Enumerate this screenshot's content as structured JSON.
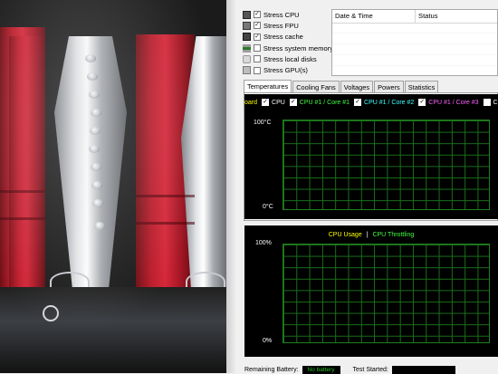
{
  "stress_options": [
    {
      "label": "Stress CPU",
      "checked": true,
      "icon": "cpu-icon"
    },
    {
      "label": "Stress FPU",
      "checked": true,
      "icon": "fpu-icon"
    },
    {
      "label": "Stress cache",
      "checked": true,
      "icon": "cache-icon"
    },
    {
      "label": "Stress system memory",
      "checked": false,
      "icon": "memory-icon"
    },
    {
      "label": "Stress local disks",
      "checked": false,
      "icon": "disk-icon"
    },
    {
      "label": "Stress GPU(s)",
      "checked": false,
      "icon": "gpu-icon"
    }
  ],
  "log": {
    "columns": [
      "Date & Time",
      "Status"
    ]
  },
  "tabs": [
    {
      "label": "Temperatures",
      "active": true
    },
    {
      "label": "Cooling Fans",
      "active": false
    },
    {
      "label": "Voltages",
      "active": false
    },
    {
      "label": "Powers",
      "active": false
    },
    {
      "label": "Statistics",
      "active": false
    }
  ],
  "temp_chart": {
    "legend": [
      {
        "label": "oard",
        "color": "#ffff00",
        "checked": true
      },
      {
        "label": "CPU",
        "color": "#ffffff",
        "checked": true
      },
      {
        "label": "CPU #1 / Core #1",
        "color": "#40ff40",
        "checked": true
      },
      {
        "label": "CPU #1 / Core #2",
        "color": "#40ffff",
        "checked": true
      },
      {
        "label": "CPU #1 / Core #3",
        "color": "#ff60ff",
        "checked": true
      },
      {
        "label": "CPU",
        "color": "#ffffff",
        "checked": false
      }
    ],
    "y_max_label": "100°C",
    "y_min_label": "0°C"
  },
  "usage_chart": {
    "title_cpu_usage": "CPU Usage",
    "separator": "|",
    "title_throttling": "CPU Throttling",
    "cpu_usage_color": "#ffff00",
    "throttling_color": "#40ff40",
    "y_max_label": "100%",
    "y_min_label": "0%"
  },
  "footer": {
    "battery_label": "Remaining Battery:",
    "battery_value": "No battery",
    "test_started_label": "Test Started:",
    "test_started_value": ""
  },
  "colors": {
    "grid": "#1a6f1a",
    "chart_bg": "#000000"
  }
}
